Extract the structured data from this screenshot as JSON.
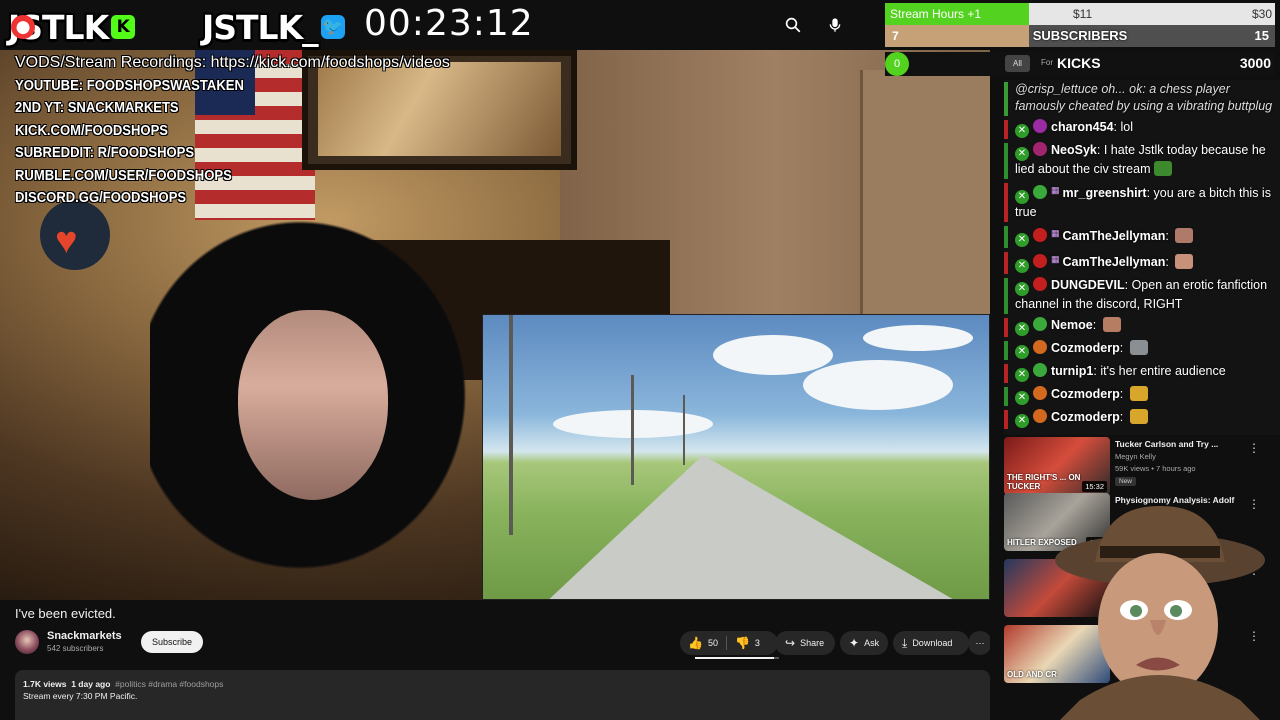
{
  "header": {
    "logo_left": "JSTLK",
    "logo_right": "JSTLK_",
    "badge_kick": "K",
    "badge_rec": "●",
    "badge_bird": "🐦",
    "timer": "00:23:12",
    "search_icon": "search-icon",
    "mic_icon": "mic-icon"
  },
  "stream_overlay": {
    "vods_line": "VODS/Stream Recordings: https://kick.com/foodshops/videos",
    "links": [
      "YOUTUBE: FOODSHOPSWASTAKEN",
      "2ND YT: SNACKMARKETS",
      "KICK.COM/FOODSHOPS",
      "SUBREDDIT: R/FOODSHOPS",
      "RUMBLE.COM/USER/FOODSHOPS",
      "DISCORD.GG/FOODSHOPS"
    ]
  },
  "goals": {
    "stream_hours": {
      "label": "Stream Hours +1",
      "value1": "$11",
      "value2": "$30",
      "fill_fraction": 0.37
    },
    "subscribers": {
      "current": "7",
      "label": "SUBSCRIBERS",
      "target": "15",
      "fill_fraction": 0.37
    },
    "kicks": {
      "current": "0",
      "label": "KICKS",
      "target": "3000",
      "all_label": "All",
      "for_label": "For"
    }
  },
  "chat": {
    "messages": [
      {
        "type": "reply",
        "text": "@crisp_lettuce oh... ok: a chess player famously cheated by using a vibrating buttplug",
        "accent": "#3a9b35"
      },
      {
        "user": "charon454",
        "text": "lol",
        "dot": "#9b2aa5",
        "mod": true
      },
      {
        "user": "NeoSyk",
        "text": "I hate Jstlk today because he lied about the civ stream",
        "dot": "#a3246e",
        "mod": true,
        "emote": "#3d8a2e"
      },
      {
        "user": "mr_greenshirt",
        "text": "you are a bitch this is true",
        "dot": "#3aa83a",
        "mod": true,
        "gift": true
      },
      {
        "user": "CamTheJellyman",
        "text": "",
        "dot": "#c41f1f",
        "mod": true,
        "gift": true,
        "emote": "#b07a6b"
      },
      {
        "user": "CamTheJellyman",
        "text": "",
        "dot": "#c41f1f",
        "mod": true,
        "gift": true,
        "emote": "#c99179"
      },
      {
        "user": "DUNGDEVIL",
        "text": "Open an erotic fanfiction channel in the discord, RIGHT",
        "dot": "#c41f1f",
        "mod": true
      },
      {
        "user": "Nemoe",
        "text": "",
        "dot": "#3aa83a",
        "mod": true,
        "emote": "#b77d63"
      },
      {
        "user": "Cozmoderp",
        "text": "",
        "dot": "#d2691e",
        "mod": true,
        "emote": "#8a8f93"
      },
      {
        "user": "turnip1",
        "text": "it's her entire audience",
        "dot": "#3aa83a",
        "mod": true
      },
      {
        "user": "Cozmoderp",
        "text": "",
        "dot": "#d2691e",
        "mod": true,
        "emote": "#d9a62c"
      },
      {
        "user": "Cozmoderp",
        "text": "",
        "dot": "#d2691e",
        "mod": true,
        "emote": "#d9a62c"
      }
    ]
  },
  "video": {
    "title": "I've been evicted.",
    "channel": "Snackmarkets",
    "subscribers": "542 subscribers",
    "subscribe_label": "Subscribe",
    "likes": "50",
    "dislikes": "3",
    "share_label": "Share",
    "ask_label": "Ask",
    "download_label": "Download",
    "like_ratio": 0.94,
    "views": "1.7K views",
    "age": "1 day ago",
    "tags": "#politics #drama #foodshops",
    "description_line": "Stream every 7:30 PM Pacific."
  },
  "recommendations": [
    {
      "title": "Tucker Carlson and Try ...",
      "channel": "Megyn Kelly",
      "meta": "59K views • 7 hours ago",
      "badge": "New",
      "duration": "15:32",
      "thumb_text": "THE RIGHT'S ... ON TUCKER"
    },
    {
      "title": "Physiognomy Analysis: Adolf",
      "channel": "",
      "meta": "",
      "badge": "",
      "duration": "16:3",
      "thumb_text": "HITLER EXPOSED"
    },
    {
      "title": "",
      "channel": "",
      "meta": "",
      "badge": "",
      "duration": "",
      "thumb_text": ""
    },
    {
      "title": "",
      "channel": "",
      "meta": "",
      "badge": "",
      "duration": "",
      "thumb_text": "OLD AND CR"
    }
  ]
}
